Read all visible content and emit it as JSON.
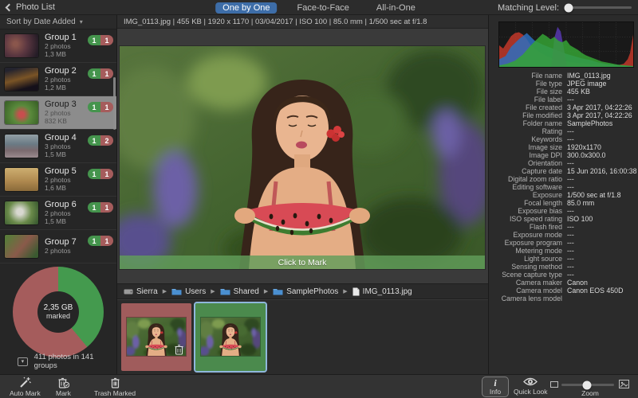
{
  "header": {
    "back_label": "Photo List",
    "tabs": [
      {
        "label": "One by One",
        "active": true
      },
      {
        "label": "Face-to-Face",
        "active": false
      },
      {
        "label": "All-in-One",
        "active": false
      }
    ],
    "matching_label": "Matching Level:",
    "matching_value_pct": 6,
    "accent_color": "#3d6da8"
  },
  "sidebar": {
    "sort_label": "Sort by Date Added",
    "groups": [
      {
        "name": "Group 1",
        "photos": "2 photos",
        "size": "1,3 MB",
        "kept": 1,
        "marked": 1,
        "selected": false,
        "thumb": "couple"
      },
      {
        "name": "Group 2",
        "photos": "2 photos",
        "size": "1,2 MB",
        "kept": 1,
        "marked": 1,
        "selected": false,
        "thumb": "night"
      },
      {
        "name": "Group 3",
        "photos": "2 photos",
        "size": "832 KB",
        "kept": 1,
        "marked": 1,
        "selected": true,
        "thumb": "watermelon"
      },
      {
        "name": "Group 4",
        "photos": "3 photos",
        "size": "1,5 MB",
        "kept": 1,
        "marked": 2,
        "selected": false,
        "thumb": "lake"
      },
      {
        "name": "Group 5",
        "photos": "2 photos",
        "size": "1,6 MB",
        "kept": 1,
        "marked": 1,
        "selected": false,
        "thumb": "field"
      },
      {
        "name": "Group 6",
        "photos": "2 photos",
        "size": "1,5 MB",
        "kept": 1,
        "marked": 1,
        "selected": false,
        "thumb": "garden"
      },
      {
        "name": "Group 7",
        "photos": "2 photos",
        "size": "",
        "kept": 1,
        "marked": 1,
        "selected": false,
        "thumb": "outdoor"
      }
    ],
    "summary": {
      "size_label": "2,35 GB",
      "sub_label": "marked",
      "marked_pct": 61,
      "kept_pct": 39,
      "marked_color": "#a55c5c",
      "kept_color": "#449a4e",
      "caption": "411 photos in 141 groups"
    }
  },
  "viewer": {
    "meta_bar": "IMG_0113.jpg  |  455 KB  |  1920 x 1170  |  03/04/2017  |  ISO 100  |  85.0 mm  |  1/500 sec at f/1.8",
    "click_to_mark": "Click to Mark",
    "breadcrumb": [
      {
        "label": "Sierra",
        "type": "drive"
      },
      {
        "label": "Users",
        "type": "folder"
      },
      {
        "label": "Shared",
        "type": "folder"
      },
      {
        "label": "SamplePhotos",
        "type": "folder"
      },
      {
        "label": "IMG_0113.jpg",
        "type": "file"
      }
    ],
    "filmstrip": [
      {
        "state": "marked",
        "trash_badge": true,
        "selected": false
      },
      {
        "state": "kept",
        "trash_badge": false,
        "selected": true
      }
    ]
  },
  "info_panel": {
    "rows": [
      {
        "label": "File name",
        "value": "IMG_0113.jpg"
      },
      {
        "label": "File type",
        "value": "JPEG image"
      },
      {
        "label": "File size",
        "value": "455 KB"
      },
      {
        "label": "File label",
        "value": "---"
      },
      {
        "label": "File created",
        "value": "3 Apr 2017, 04:22:26"
      },
      {
        "label": "File modified",
        "value": "3 Apr 2017, 04:22:26"
      },
      {
        "label": "Folder name",
        "value": "SamplePhotos"
      },
      {
        "label": "Rating",
        "value": "---"
      },
      {
        "label": "Keywords",
        "value": "---"
      },
      {
        "label": "Image size",
        "value": "1920x1170"
      },
      {
        "label": "Image DPI",
        "value": "300.0x300.0"
      },
      {
        "label": "Orientation",
        "value": "---"
      },
      {
        "label": "Capture date",
        "value": "15 Jun 2016, 16:00:38"
      },
      {
        "label": "Digital zoom ratio",
        "value": "---"
      },
      {
        "label": "Editing software",
        "value": "---"
      },
      {
        "label": "Exposure",
        "value": "1/500 sec at f/1.8"
      },
      {
        "label": "Focal length",
        "value": "85.0 mm"
      },
      {
        "label": "Exposure bias",
        "value": "---"
      },
      {
        "label": "ISO speed rating",
        "value": "ISO 100"
      },
      {
        "label": "Flash fired",
        "value": "---"
      },
      {
        "label": "Exposure mode",
        "value": "---"
      },
      {
        "label": "Exposure program",
        "value": "---"
      },
      {
        "label": "Metering mode",
        "value": "---"
      },
      {
        "label": "Light source",
        "value": "---"
      },
      {
        "label": "Sensing method",
        "value": "---"
      },
      {
        "label": "Scene capture type",
        "value": "---"
      },
      {
        "label": "Camera maker",
        "value": "Canon"
      },
      {
        "label": "Camera model",
        "value": "Canon EOS 450D"
      },
      {
        "label": "Camera lens model",
        "value": ""
      }
    ]
  },
  "toolbar": {
    "left": [
      {
        "label": "Auto Mark",
        "icon": "magic-wand-icon"
      },
      {
        "label": "Mark",
        "icon": "trash-check-icon"
      },
      {
        "label": "Trash Marked",
        "icon": "trash-icon"
      }
    ],
    "right": {
      "info_label": "Info",
      "quicklook_label": "Quick Look",
      "zoom_label": "Zoom",
      "zoom_value_pct": 48
    }
  }
}
